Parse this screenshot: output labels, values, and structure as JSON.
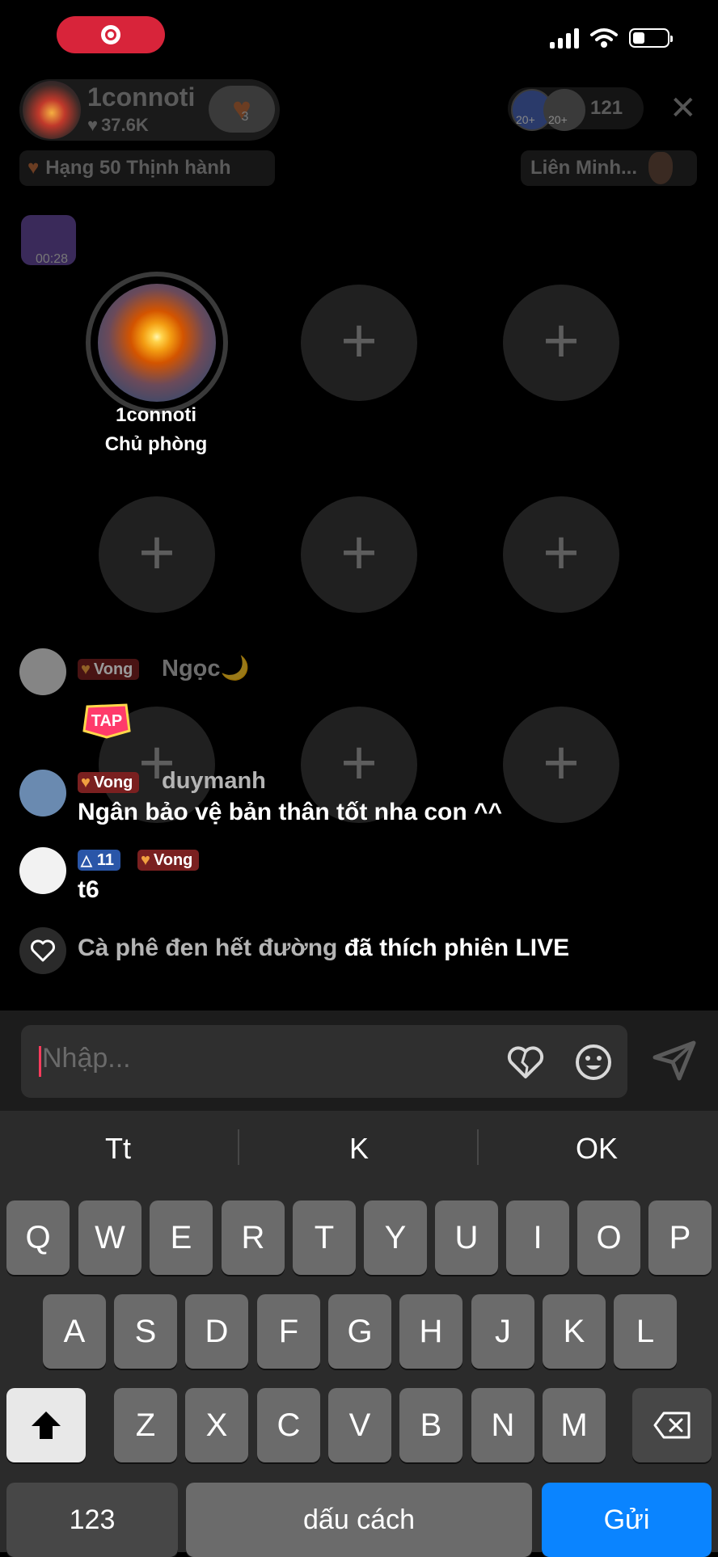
{
  "host": {
    "name": "1connoti",
    "likes": "37.6K",
    "follow_count": "3",
    "rank": "Hạng 50 Thịnh hành",
    "game": "Liên Minh...",
    "viewer_count": "121",
    "viewer_badge_1": "20+",
    "viewer_badge_2": "20+"
  },
  "gift": {
    "timer": "00:28"
  },
  "seats": {
    "host_name": "1connoti",
    "host_role": "Chủ phòng",
    "empty_symbol": "+"
  },
  "comments": [
    {
      "badge": "Vong",
      "user": "Ngọc🌙",
      "text": ""
    },
    {
      "badge": "Vong",
      "user": "duymanh",
      "text": "Ngân bảo vệ bản thân tốt nha con ^^"
    },
    {
      "level": "11",
      "badge": "Vong",
      "user": "",
      "text": "t6"
    }
  ],
  "tap_label": "TAP",
  "like_event": {
    "user": "Cà phê đen hết đường",
    "action": "đã thích phiên LIVE"
  },
  "input": {
    "placeholder": "Nhập..."
  },
  "keyboard": {
    "suggestions": [
      "Tt",
      "K",
      "OK"
    ],
    "row1": [
      "Q",
      "W",
      "E",
      "R",
      "T",
      "Y",
      "U",
      "I",
      "O",
      "P"
    ],
    "row2": [
      "A",
      "S",
      "D",
      "F",
      "G",
      "H",
      "J",
      "K",
      "L"
    ],
    "row3": [
      "Z",
      "X",
      "C",
      "V",
      "B",
      "N",
      "M"
    ],
    "numbers_label": "123",
    "space_label": "dấu cách",
    "send_label": "Gửi"
  },
  "colors": {
    "accent_red": "#d8243a",
    "send_blue": "#0a84ff",
    "badge_red": "#7a2020",
    "badge_blue": "#2a56a8"
  }
}
